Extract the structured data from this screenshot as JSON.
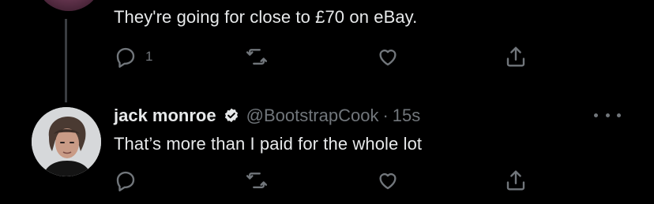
{
  "previous_tweet": {
    "text": "They're going for close to £70 on eBay.",
    "reply_count": "1"
  },
  "reply_tweet": {
    "display_name": "jack monroe",
    "handle": "@BootstrapCook",
    "separator": "·",
    "time": "15s",
    "text": "That’s more than I paid for the whole lot",
    "reply_count": ""
  },
  "icons": {
    "reply": "reply-icon",
    "retweet": "retweet-icon",
    "like": "heart-icon",
    "share": "share-icon",
    "verified": "verified-badge-icon",
    "more": "more-icon"
  },
  "colors": {
    "background": "#000000",
    "text": "#e7e9ea",
    "secondary": "#71767b",
    "thread_line": "#3a3d41"
  }
}
